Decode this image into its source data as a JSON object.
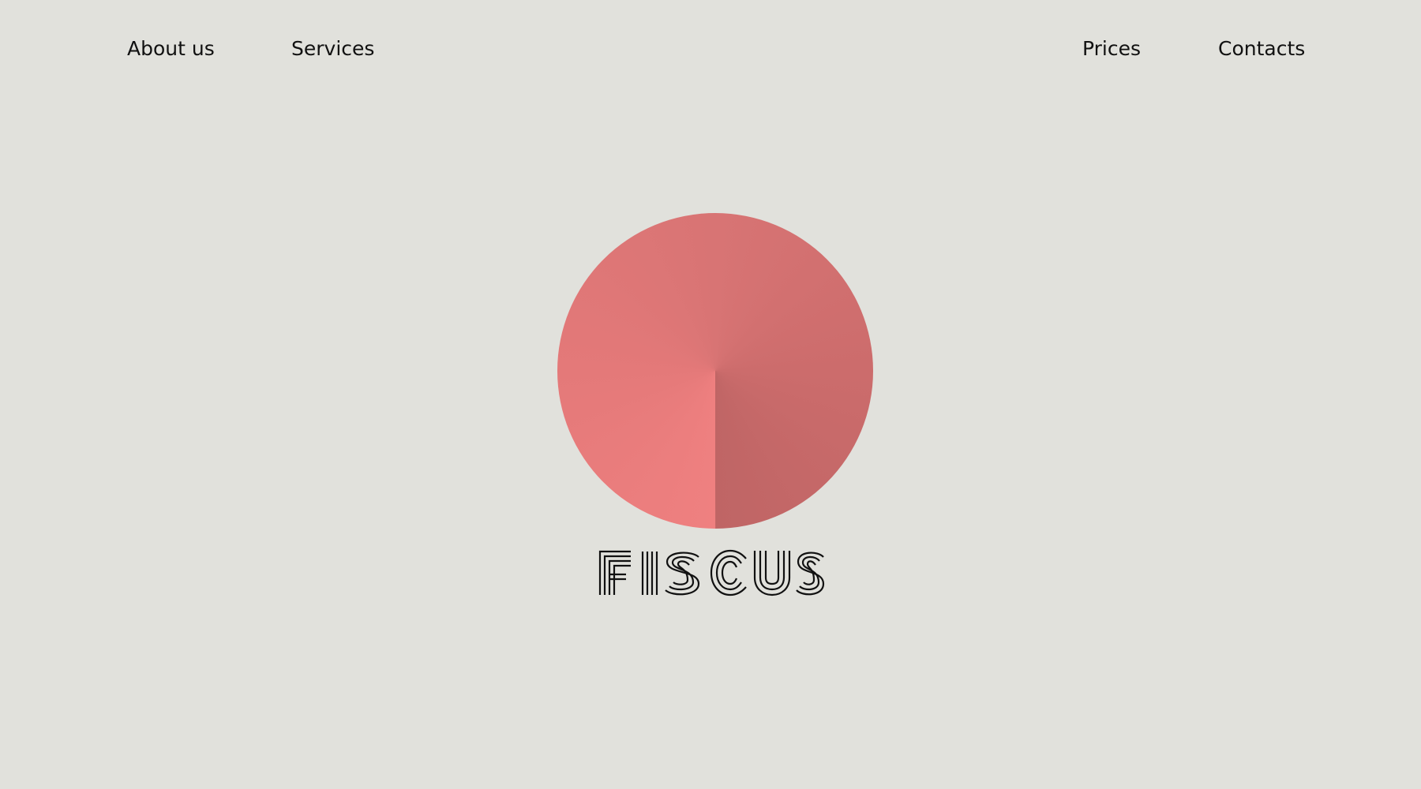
{
  "nav": {
    "left": [
      {
        "label": "About us"
      },
      {
        "label": "Services"
      }
    ],
    "right": [
      {
        "label": "Prices"
      },
      {
        "label": "Contacts"
      }
    ]
  },
  "logo": {
    "icon": "pie-circle-logo",
    "wordmark": "FISCUS",
    "colors": {
      "background": "#e1e1dc",
      "circle_light": "#ef8080",
      "circle_mid": "#d87474",
      "circle_dark": "#bf6565",
      "wordmark_stroke": "#111111"
    }
  }
}
